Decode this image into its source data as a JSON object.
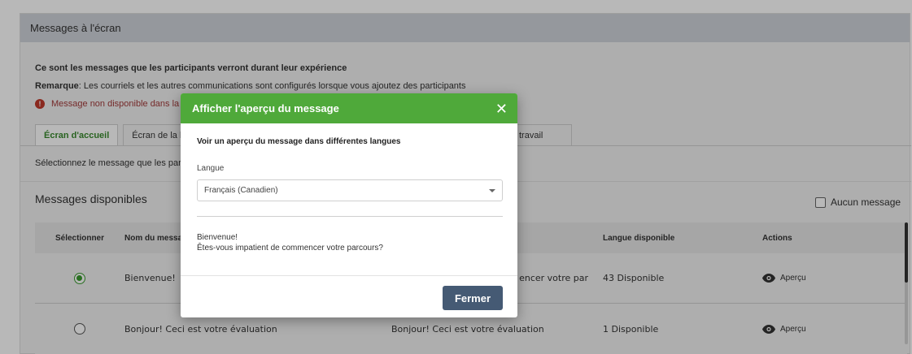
{
  "panel": {
    "title": "Messages à l'écran",
    "intro": "Ce sont les messages que les participants verront durant leur expérience",
    "note_label": "Remarque",
    "note_text": ": Les courriels et les autres communications sont configurés lorsque vous ajoutez des participants",
    "warning": "Message non disponible dans la"
  },
  "tabs": [
    {
      "label": "Écran d'accueil",
      "active": true
    },
    {
      "label": "Écran de la lis"
    },
    {
      "label": "travail"
    }
  ],
  "subtext": "Sélectionnez le message que les par",
  "messages_title": "Messages disponibles",
  "no_message_label": "Aucun message",
  "table": {
    "headers": [
      "Sélectionner",
      "Nom du messag",
      "Langue disponible",
      "Actions"
    ],
    "rows": [
      {
        "name": "Bienvenue!",
        "text": "encer votre par",
        "lang": "43 Disponible",
        "action": "Aperçu",
        "selected": true
      },
      {
        "name": "Bonjour! Ceci est votre évaluation",
        "text": "Bonjour! Ceci est votre évaluation",
        "lang": "1 Disponible",
        "action": "Aperçu",
        "selected": false
      }
    ]
  },
  "modal": {
    "title": "Afficher l'aperçu du message",
    "subtitle": "Voir un aperçu du message dans différentes langues",
    "language_label": "Langue",
    "language_value": "Français (Canadien)",
    "preview_line1": "Bienvenue!",
    "preview_line2": "Êtes-vous impatient de commencer votre parcours?",
    "close_button": "Fermer"
  },
  "colors": {
    "accent_green": "#4fa93a",
    "button_dark": "#455a74",
    "warning_red": "#c0392b"
  }
}
